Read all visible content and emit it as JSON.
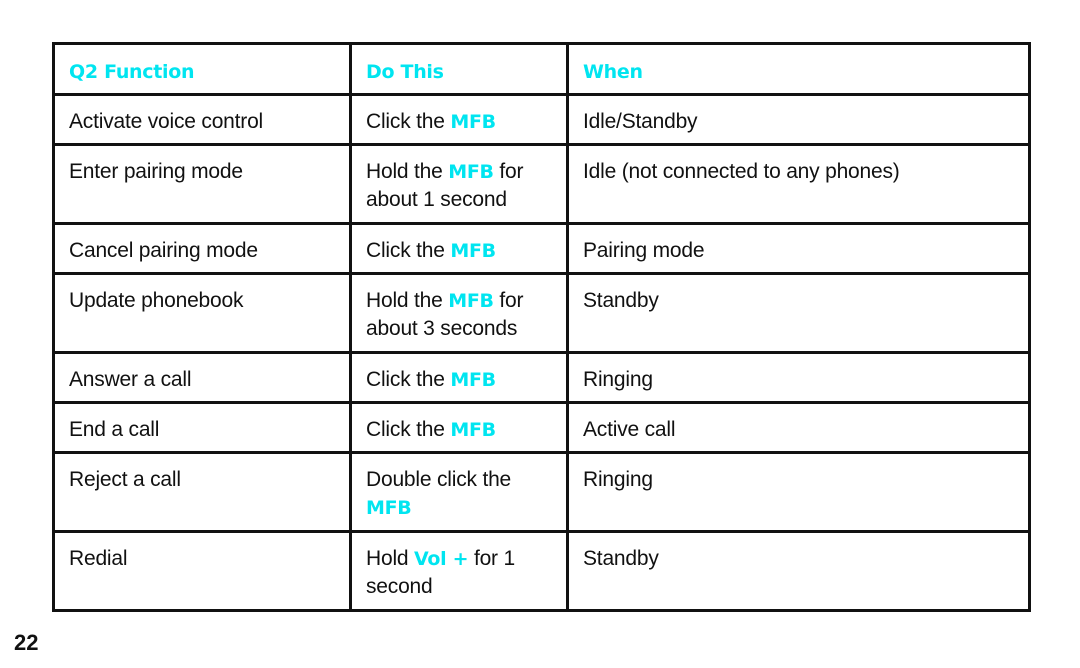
{
  "accent_color": "#00e5f0",
  "table": {
    "headers": [
      "Q2 Function",
      "Do This",
      "When"
    ],
    "rows": [
      {
        "function": "Activate voice control",
        "do_this": {
          "pre": "Click the ",
          "key": "MFB",
          "post": ""
        },
        "when": "Idle/Standby"
      },
      {
        "function": "Enter pairing mode",
        "do_this": {
          "pre": "Hold the ",
          "key": "MFB",
          "post": " for about 1 second"
        },
        "when": "Idle (not connected to any phones)"
      },
      {
        "function": "Cancel pairing mode",
        "do_this": {
          "pre": "Click the ",
          "key": "MFB",
          "post": ""
        },
        "when": "Pairing mode"
      },
      {
        "function": "Update phonebook",
        "do_this": {
          "pre": "Hold the ",
          "key": "MFB",
          "post": " for about 3 seconds"
        },
        "when": "Standby"
      },
      {
        "function": "Answer a call",
        "do_this": {
          "pre": "Click the ",
          "key": "MFB",
          "post": ""
        },
        "when": "Ringing"
      },
      {
        "function": "End a call",
        "do_this": {
          "pre": "Click the ",
          "key": "MFB",
          "post": ""
        },
        "when": "Active call"
      },
      {
        "function": "Reject a call",
        "do_this": {
          "pre": "Double click the ",
          "key": "MFB",
          "post": ""
        },
        "when": "Ringing"
      },
      {
        "function": "Redial",
        "do_this": {
          "pre": "Hold ",
          "key": "Vol +",
          "post": " for 1 second"
        },
        "when": "Standby"
      }
    ]
  },
  "page_number": "22"
}
